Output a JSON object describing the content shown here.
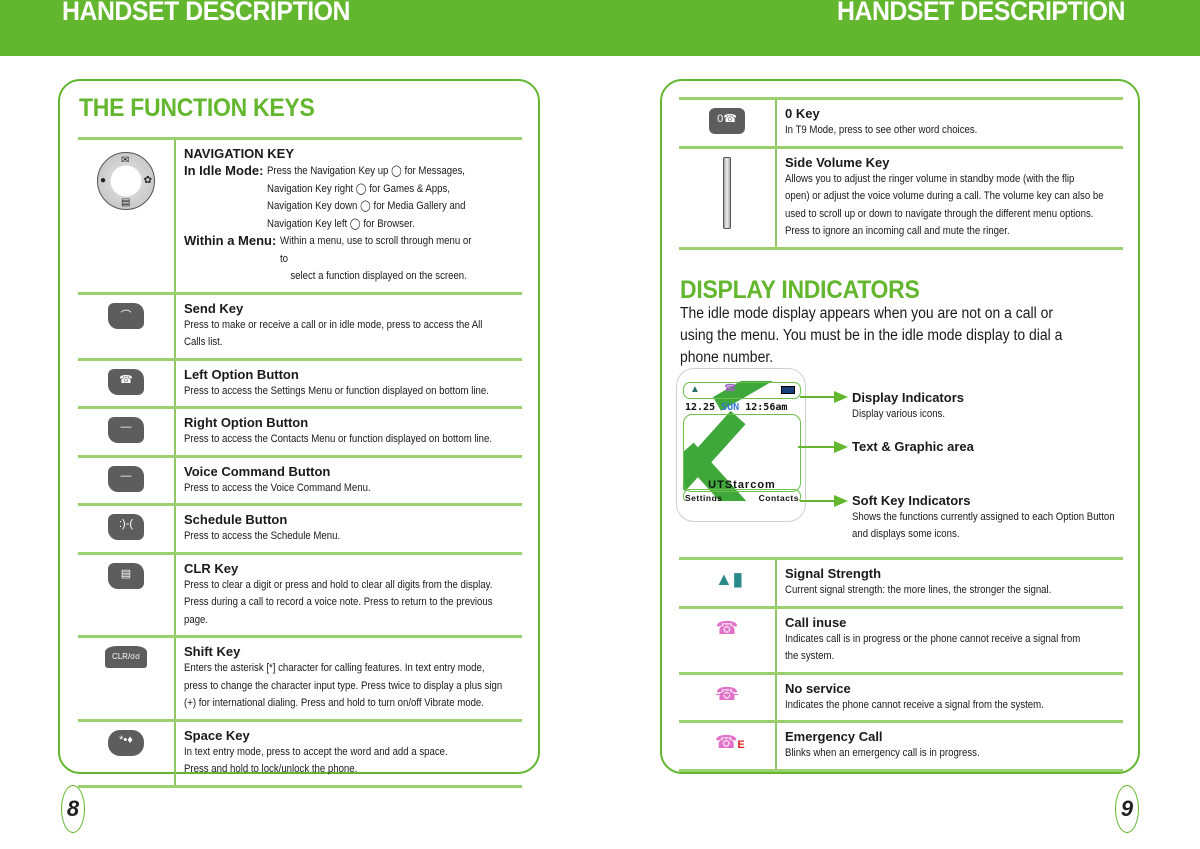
{
  "header": {
    "left_title": "HANDSET DESCRIPTION",
    "right_title": "HANDSET DESCRIPTION",
    "brand_color": "#63b72e"
  },
  "left_page": {
    "section_title": "THE FUNCTION KEYS",
    "page_number": "8",
    "navigation_key": {
      "title": "NAVIGATION KEY",
      "idle_label": "In Idle Mode:",
      "idle_lines": [
        "Press the Navigation Key up",
        "for Messages,",
        "Navigation Key right",
        "for Games & Apps,",
        "Navigation Key down",
        "for Media Gallery and",
        "Navigation Key left",
        "for Browser."
      ],
      "menu_label": "Within a Menu:",
      "menu_lines": [
        "Within a menu, use to scroll through menu or to",
        "select a function displayed on the screen."
      ]
    },
    "keys": [
      {
        "icon": "send-key-icon",
        "glyph": "⌒",
        "title": "Send Key",
        "lines": [
          "Press to make or receive a call or in idle mode, press to access the All",
          "Calls list."
        ]
      },
      {
        "icon": "left-option-key-icon",
        "glyph": "☎",
        "title": "Left Option Button",
        "lines": [
          "Press to access the Settings Menu or function displayed on bottom line."
        ]
      },
      {
        "icon": "right-option-key-icon",
        "glyph": "—",
        "title": "Right Option Button",
        "lines": [
          "Press to access the Contacts Menu or function displayed on bottom line."
        ]
      },
      {
        "icon": "voice-command-key-icon",
        "glyph": "—",
        "title": "Voice Command Button",
        "lines": [
          "Press to access the Voice Command Menu."
        ]
      },
      {
        "icon": "schedule-key-icon",
        "glyph": ":)-(",
        "title": "Schedule Button",
        "lines": [
          "Press to access the Schedule Menu."
        ]
      },
      {
        "icon": "clr-key-icon",
        "glyph": "▤",
        "title": "CLR Key",
        "lines": [
          "Press to clear a digit or press and hold to clear all digits from the display.",
          "Press during a call to record a voice note.  Press to return to the previous",
          "page."
        ]
      },
      {
        "icon": "shift-key-icon",
        "glyph": "CLR/σσ",
        "title": "Shift Key",
        "lines": [
          "Enters the asterisk [*] character for calling features.  In text entry mode,",
          "press to change the character input type.  Press twice to display a plus sign",
          "(+) for international dialing.  Press and hold to turn on/off Vibrate mode."
        ]
      },
      {
        "icon": "space-key-icon",
        "glyph": "*•♦",
        "title": "Space Key",
        "lines": [
          "In text entry mode, press to accept the word and add a space.",
          "Press and hold to lock/unlock the phone."
        ]
      }
    ]
  },
  "right_page": {
    "page_number": "9",
    "keys": [
      {
        "icon": "zero-key-icon",
        "glyph": "0☎",
        "title": "0 Key",
        "lines": [
          "In T9 Mode, press to see other word choices."
        ]
      },
      {
        "icon": "side-volume-key-icon",
        "glyph": "",
        "title": "Side Volume Key",
        "lines": [
          "Allows you to adjust the ringer volume in standby mode (with the flip",
          "open) or adjust the voice volume during a call.  The volume key can also be",
          "used to scroll up or down to navigate through the different menu options.",
          "Press to ignore an incoming call and mute the ringer."
        ]
      }
    ],
    "display_section": {
      "title": "DISPLAY INDICATORS",
      "intro": "The idle mode display appears when you are not on a call or using the menu. You must be in the idle mode display to dial a phone number.",
      "phone_screen": {
        "date": "12.25",
        "day": "SUN",
        "time": "12:56am",
        "brand": "UTStarcom",
        "soft_left": "Settings",
        "soft_right": "Contacts"
      },
      "callouts": [
        {
          "title": "Display Indicators",
          "desc": [
            "Display various icons."
          ]
        },
        {
          "title": "Text & Graphic area",
          "desc": []
        },
        {
          "title": "Soft Key Indicators",
          "desc": [
            "Shows the functions currently assigned to each Option Button",
            "and displays some icons."
          ]
        }
      ]
    },
    "indicators": [
      {
        "icon": "signal-strength-icon",
        "glyph": "📶",
        "title": "Signal Strength",
        "lines": [
          "Current signal strength: the more lines, the stronger the signal."
        ]
      },
      {
        "icon": "call-in-use-icon",
        "glyph": "☎",
        "title": "Call inuse",
        "lines": [
          "Indicates call is in progress or the phone cannot receive a signal from",
          "the system."
        ]
      },
      {
        "icon": "no-service-icon",
        "glyph": "☎",
        "title": "No service",
        "lines": [
          "Indicates the phone cannot receive a signal from the system."
        ]
      },
      {
        "icon": "emergency-call-icon",
        "glyph": "☎",
        "title": "Emergency Call",
        "lines": [
          "Blinks when an emergency call is in progress."
        ]
      }
    ]
  }
}
